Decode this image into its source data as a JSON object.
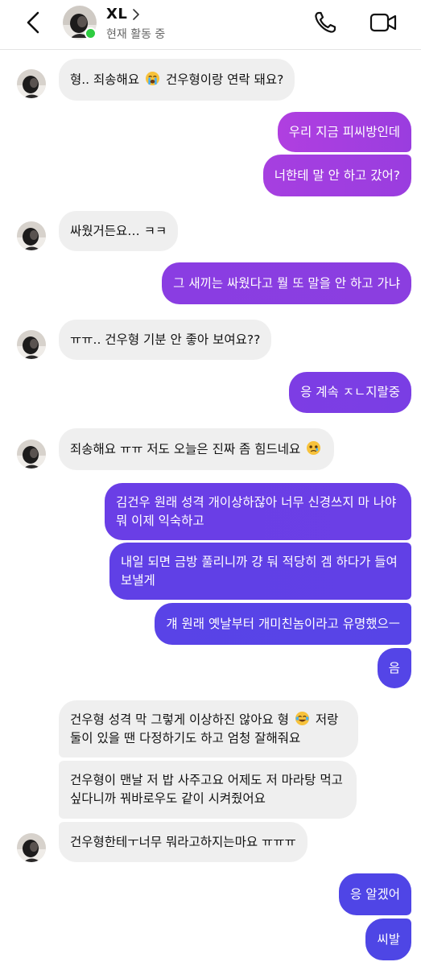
{
  "header": {
    "name": "XL",
    "status": "현재 활동 중"
  },
  "colors": {
    "incoming_bubble": "#efefef",
    "online": "#2ecc40",
    "gradient_start": "#9b3ce0",
    "gradient_end": "#4f45e6"
  },
  "icons": [
    "back-arrow-icon",
    "chevron-right-icon",
    "phone-icon",
    "video-camera-icon",
    "loudly-crying-face-emoji",
    "tears-of-joy-emoji",
    "holding-back-tears-emoji"
  ],
  "messages": [
    {
      "dir": "in",
      "text": "형.. 죄송해요 ",
      "emoji": "😭",
      "text2": " 건우형이랑 연락 돼요?"
    },
    {
      "dir": "out",
      "text": "우리 지금 피씨방인데"
    },
    {
      "dir": "out",
      "text": "너한테 말 안 하고 갔어?"
    },
    {
      "dir": "in",
      "text": "싸웠거든요… ㅋㅋ"
    },
    {
      "dir": "out",
      "text": "그 새끼는 싸웠다고 뭘 또 말을 안 하고 가냐"
    },
    {
      "dir": "in",
      "text": "ㅠㅠ.. 건우형 기분 안 좋아 보여요??"
    },
    {
      "dir": "out",
      "text": "응 계속 ㅈㄴ지랄중"
    },
    {
      "dir": "in",
      "text": "죄송해요 ㅠㅠ 저도 오늘은 진짜 좀 힘드네요 ",
      "emoji": "🥲"
    },
    {
      "dir": "out",
      "text": "김건우 원래 성격 개이상하잖아 너무 신경쓰지 마 나야 뭐 이제 익숙하고"
    },
    {
      "dir": "out",
      "text": "내일 되면 금방 풀리니까 걍 둬 적당히 겜 하다가 들여보낼게"
    },
    {
      "dir": "out",
      "text": "걔 원래 옛날부터 개미친놈이라고 유명했으ㅡ"
    },
    {
      "dir": "out",
      "text": "음"
    },
    {
      "dir": "in",
      "text": "건우형 성격 막 그렇게 이상하진 않아요 형 ",
      "emoji": "😂",
      "text2": " 저랑 둘이 있을 땐 다정하기도 하고 엄청 잘해줘요"
    },
    {
      "dir": "in",
      "text": "건우형이 맨날 저 밥 사주고요 어제도 저 마라탕 먹고 싶다니까 꿔바로우도 같이 시켜줬어요"
    },
    {
      "dir": "in",
      "text": "건우형한테ㅜ너무 뭐라고하지는마요 ㅠㅠㅠ"
    },
    {
      "dir": "out",
      "text": "응 알겠어"
    },
    {
      "dir": "out",
      "text": "씨발"
    }
  ]
}
